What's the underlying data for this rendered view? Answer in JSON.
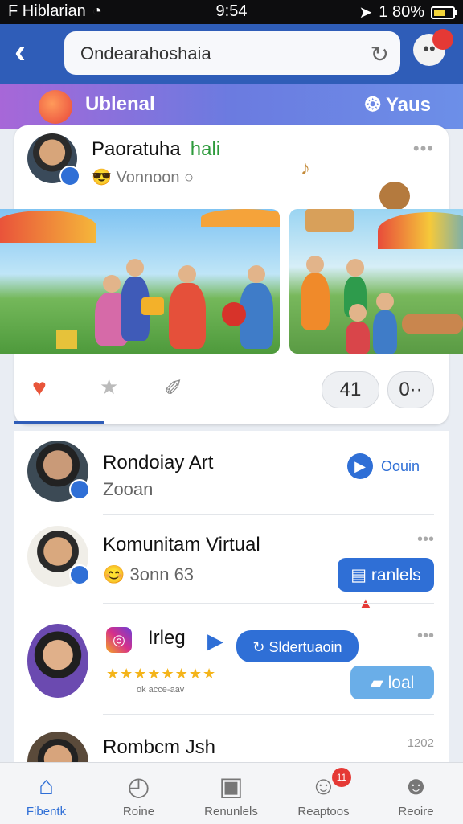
{
  "status": {
    "carrier": "F Hiblarian",
    "time": "9:54",
    "battery": "1 80%"
  },
  "search": {
    "value": "Ondearahoshaia"
  },
  "banner": {
    "title": "Ublenal",
    "right": "Yaus"
  },
  "post": {
    "name": "Paoratuha",
    "highlight": "hali",
    "sub": "Vonnoon",
    "dots": "•••",
    "pill1": "41",
    "pill2": "0··"
  },
  "list": [
    {
      "name": "Rondoiay Art",
      "sub": "Zooan",
      "action": "Oouin"
    },
    {
      "name": "Komunitam Virtual",
      "sub": "3onn 63",
      "action": "ranlels"
    },
    {
      "name": "Irleg",
      "action": "Sldertuaoin",
      "action2": "loal",
      "rating_text": "ok acce-aav"
    },
    {
      "name": "Rombcm Jsh",
      "time": "1202"
    }
  ],
  "nav": [
    {
      "label": "Fibentk",
      "icon": "home-icon"
    },
    {
      "label": "Roine",
      "icon": "chat-icon"
    },
    {
      "label": "Renunlels",
      "icon": "camera-icon"
    },
    {
      "label": "Reaptoos",
      "icon": "people-icon",
      "badge": "11"
    },
    {
      "label": "Reoire",
      "icon": "profile-icon"
    }
  ],
  "colors": {
    "primary": "#2f5db8",
    "accent": "#2f6fd6",
    "alert": "#e53935"
  }
}
